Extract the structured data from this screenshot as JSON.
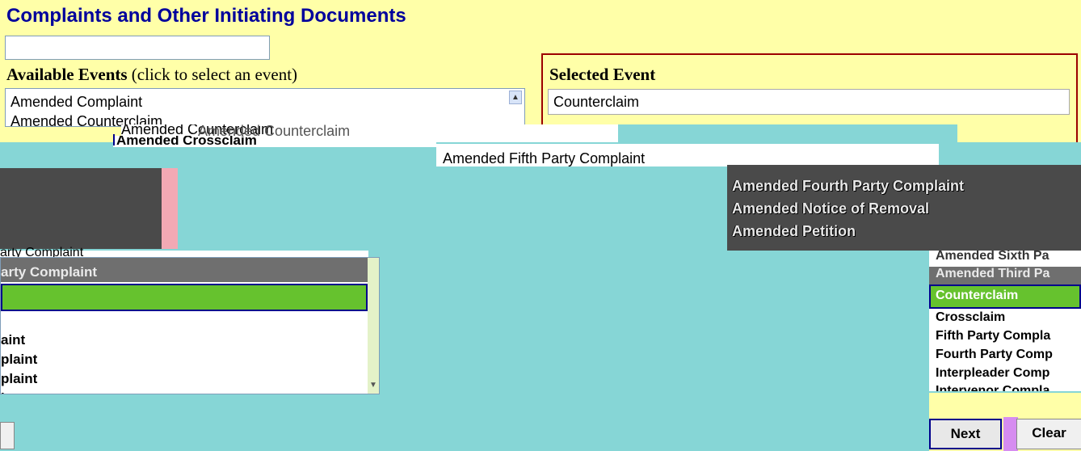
{
  "page": {
    "title": "Complaints and Other Initiating Documents"
  },
  "search": {
    "value": ""
  },
  "available": {
    "label_bold": "Available Events",
    "label_hint": "(click to select an event)",
    "items": [
      "Amended Complaint",
      "Amended Counterclaim",
      "Amended Crossclaim",
      "Amended Fifth Party Complaint",
      "Amended Fourth Party Complaint",
      "Amended Notice of Removal",
      "Amended Petition",
      "Amended Sixth Party Complaint",
      "Amended Third Party Complaint",
      "Counterclaim",
      "Crossclaim",
      "Fifth Party Complaint",
      "Fourth Party Complaint",
      "Interpleader Complaint",
      "Intervenor Complaint"
    ],
    "fragments": {
      "overlap_a": "Amended Counterclaim",
      "overlap_b": "Amended Counterclaim",
      "row3": "Amended Crossclaim",
      "row_mid": "Amended Fifth Party Complaint",
      "grey1": "Amended Fourth Party Complaint",
      "grey2": "Amended Notice of Removal",
      "grey3": "Amended Petition",
      "left1": "arty Complaint",
      "left2": "arty Complaint",
      "left3": "aint",
      "left4": "plaint",
      "left5": "plaint",
      "left6": "int",
      "right1": "Amended Sixth Pa",
      "right2": "Amended Third Pa",
      "right3": "Counterclaim",
      "right4": "Crossclaim",
      "right5": "Fifth Party Compla",
      "right6": "Fourth Party Comp",
      "right7": "Interpleader Comp",
      "right8": "Intervenor Compla"
    },
    "selected_index": 9
  },
  "selected_event": {
    "label": "Selected Event",
    "value": "Counterclaim"
  },
  "buttons": {
    "next": "Next",
    "clear": "Clear"
  },
  "colors": {
    "title": "#00009c",
    "highlight": "#66c22e",
    "panel_border": "#9c0000",
    "focus_border": "#00008b"
  }
}
